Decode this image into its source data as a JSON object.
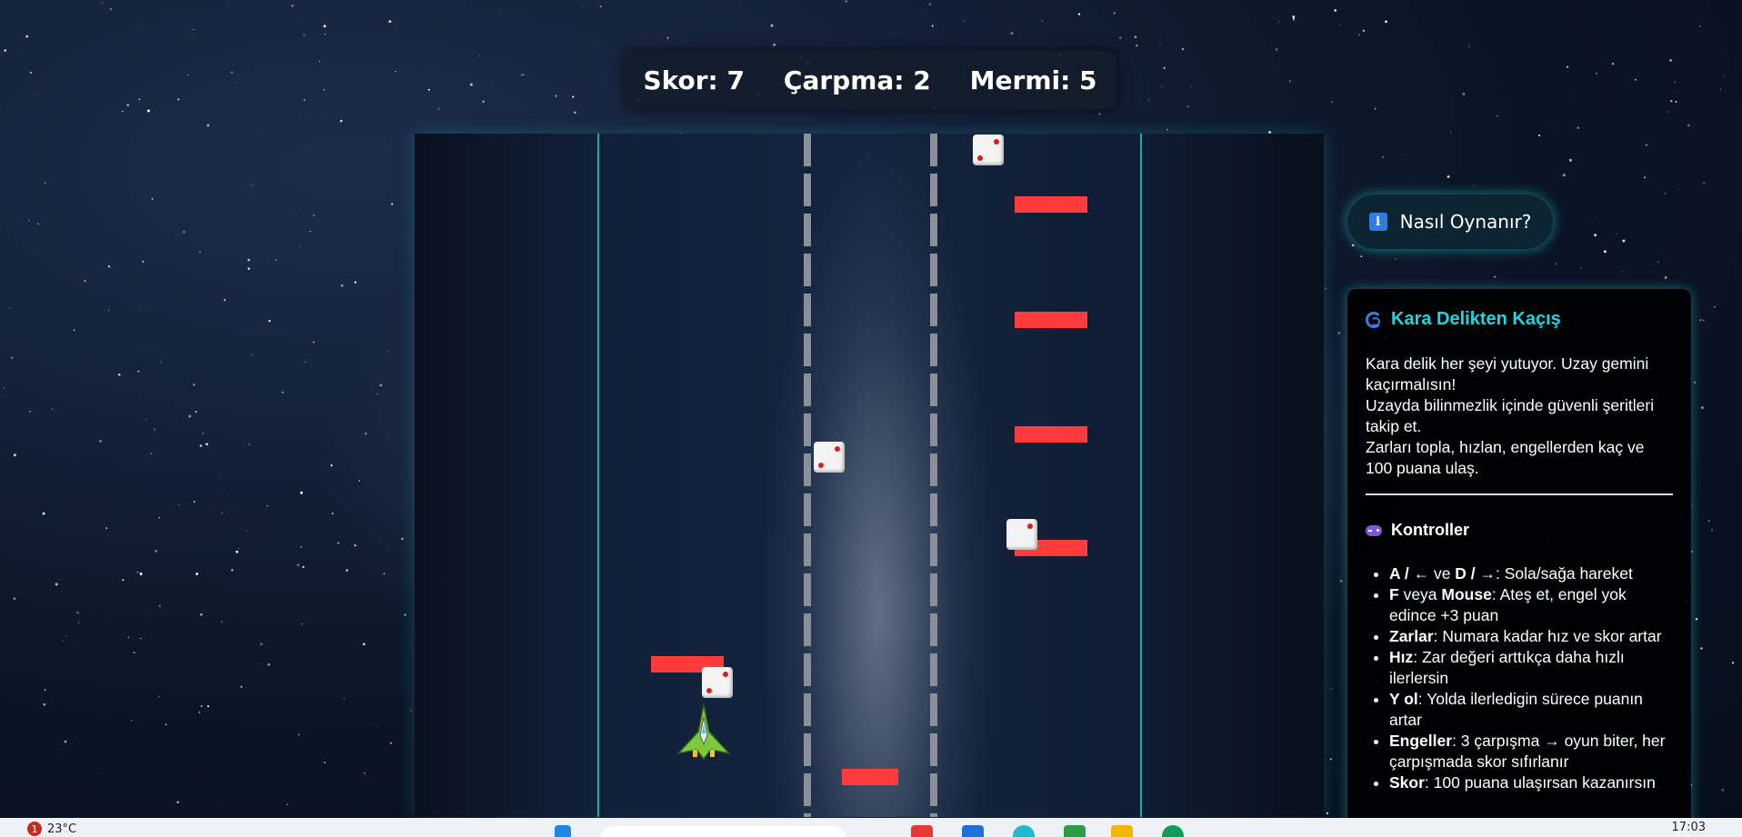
{
  "hud": {
    "score": "Skor: 7",
    "collisions": "Çarpma: 2",
    "ammo": "Mermi: 5"
  },
  "help_button": {
    "label": "Nasıl Oynanır?",
    "icon": "info-icon"
  },
  "panel": {
    "title": "Kara Delikten Kaçış",
    "title_icon": "spiral-icon",
    "intro": [
      "Kara delik her şeyi yutuyor. Uzay gemini kaçırmalısın!",
      "Uzayda bilinmezlik içinde güvenli şeritleri takip et.",
      "Zarları topla, hızlan, engellerden kaç ve 100 puana ulaş."
    ],
    "controls_title": "Kontroller",
    "controls_icon": "gamepad-icon",
    "controls": [
      {
        "key": "A / ",
        "mid": "← ve ",
        "key2": "D / ",
        "text": "→: Sola/sağa hareket"
      },
      {
        "key": "F",
        "mid": " veya ",
        "key2": "Mouse",
        "text": ": Ateş et, engel yok edince +3 puan"
      },
      {
        "key": "Zarlar",
        "text": ": Numara kadar hız ve skor artar"
      },
      {
        "key": "Hız",
        "text": ": Zar değeri arttıkça daha hızlı ilerlersin"
      },
      {
        "key": "Y ol",
        "text": ": Yolda ilerledigin sürece puanın artar"
      },
      {
        "key": "Engeller",
        "text": ": 3 çarpışma → oyun biter, her çarpışmada skor sıfırlanır"
      },
      {
        "key": "Skor",
        "text": ": 100 puana ulaşırsan kazanırsın"
      }
    ]
  },
  "taskbar": {
    "notification_count": "1",
    "temperature": "23°C",
    "time": "17:03"
  },
  "colors": {
    "obstacle": "#ff3b3b",
    "lane_edge": "#19b39a",
    "title_accent": "#1fd6e0"
  }
}
